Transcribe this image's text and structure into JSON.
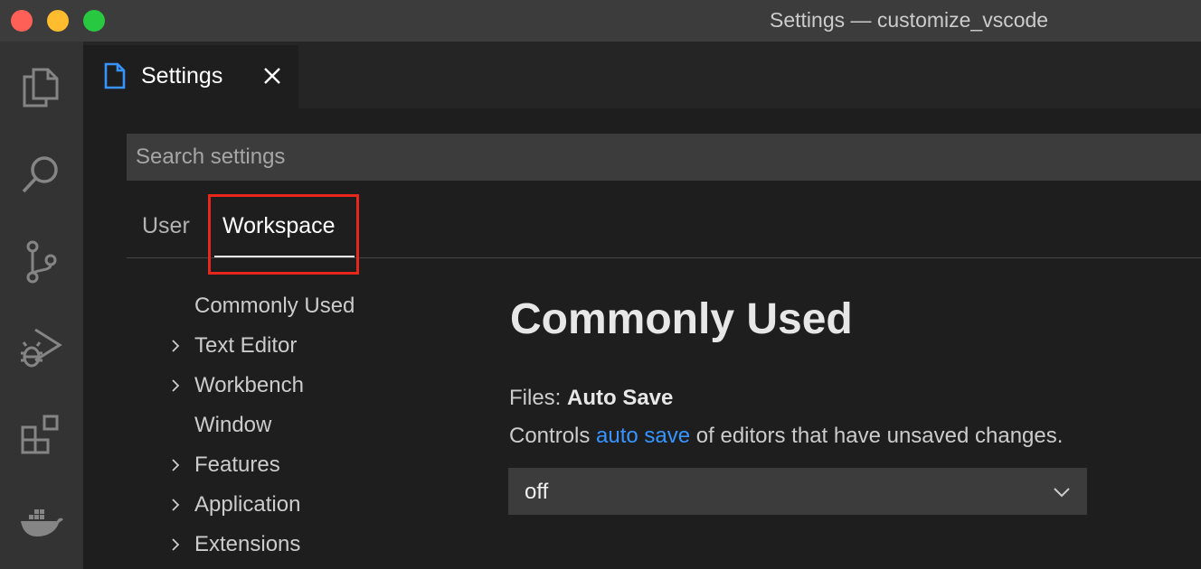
{
  "window": {
    "title": "Settings — customize_vscode"
  },
  "activity_bar": {
    "icons": [
      "files-icon",
      "search-icon",
      "source-control-icon",
      "run-debug-icon",
      "extensions-icon",
      "docker-icon"
    ]
  },
  "editor_tab": {
    "label": "Settings"
  },
  "search": {
    "placeholder": "Search settings"
  },
  "scope_tabs": {
    "user": "User",
    "workspace": "Workspace",
    "active": "Workspace"
  },
  "toc": {
    "items": [
      {
        "label": "Commonly Used",
        "has_children": false
      },
      {
        "label": "Text Editor",
        "has_children": true
      },
      {
        "label": "Workbench",
        "has_children": true
      },
      {
        "label": "Window",
        "has_children": false
      },
      {
        "label": "Features",
        "has_children": true
      },
      {
        "label": "Application",
        "has_children": true
      },
      {
        "label": "Extensions",
        "has_children": true
      }
    ]
  },
  "main": {
    "section_title": "Commonly Used",
    "setting": {
      "category": "Files: ",
      "name": "Auto Save",
      "desc_before": "Controls ",
      "desc_link": "auto save",
      "desc_after": " of editors that have unsaved changes.",
      "value": "off"
    }
  },
  "colors": {
    "accent_link": "#3794ff",
    "highlight_border": "#e8261b",
    "file_icon": "#3794ff"
  }
}
